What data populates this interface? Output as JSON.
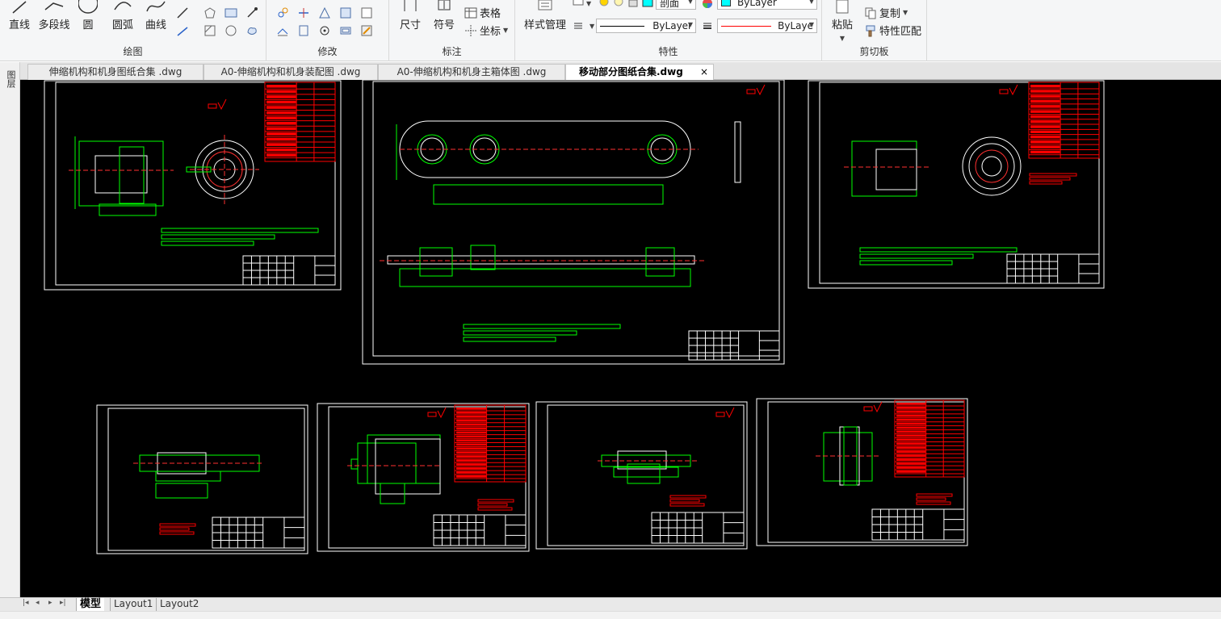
{
  "ribbon": {
    "draw": {
      "title": "绘图",
      "tools": [
        "直线",
        "多段线",
        "圆",
        "圆弧",
        "曲线"
      ]
    },
    "modify": {
      "title": "修改"
    },
    "annotate": {
      "title": "标注",
      "dimension": "尺寸",
      "symbol": "符号",
      "table": "表格",
      "coordinate": "坐标"
    },
    "properties": {
      "title": "特性",
      "style_manager": "样式管理",
      "layer_value": "ByLayer",
      "linetype_value": "ByLayer",
      "lineweight_value": "ByLaye",
      "layer_frag": "剖面"
    },
    "clipboard": {
      "title": "剪切板",
      "paste": "粘贴",
      "copy": "复制",
      "match_properties": "特性匹配"
    }
  },
  "tabs": [
    {
      "label": "伸缩机构和机身图纸合集 .dwg"
    },
    {
      "label": "A0-伸缩机构和机身装配图 .dwg"
    },
    {
      "label": "A0-伸缩机构和机身主箱体图 .dwg"
    },
    {
      "label": "移动部分图纸合集.dwg"
    }
  ],
  "tab_close": "×",
  "left_strip": {
    "label": "图层"
  },
  "layout_tabs": [
    "模型",
    "Layout1",
    "Layout2"
  ],
  "nav_buttons": [
    "|◂",
    "◂",
    "▸",
    "▸|"
  ],
  "colors": {
    "canvas": "#000000",
    "frame": "#ffffff",
    "geometry": "#00ff00",
    "titleblock": "#ff0000",
    "center": "#ff3030"
  }
}
